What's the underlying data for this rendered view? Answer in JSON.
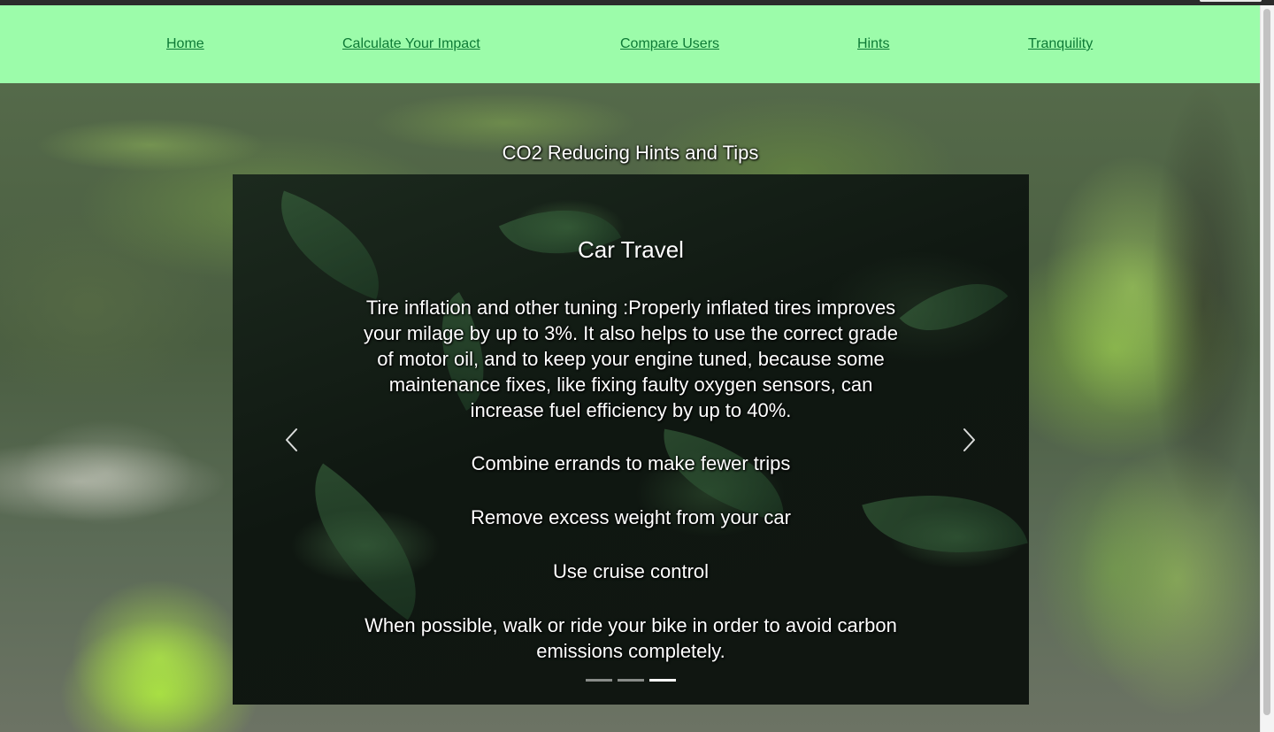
{
  "nav": {
    "items": [
      {
        "label": "Home"
      },
      {
        "label": "Calculate Your Impact"
      },
      {
        "label": "Compare Users"
      },
      {
        "label": "Hints"
      },
      {
        "label": "Tranquility"
      }
    ],
    "background_color": "#9cfcaa",
    "link_color": "#0e7a36"
  },
  "page": {
    "heading": "CO2 Reducing Hints and Tips"
  },
  "carousel": {
    "slide_title": "Car Travel",
    "hints": [
      "Tire inflation and other tuning :Properly inflated tires improves your milage by up to 3%. It also helps to use the correct grade of motor oil, and to keep your engine tuned, because some maintenance fixes, like fixing faulty oxygen sensors, can increase fuel efficiency by up to 40%.",
      "Combine errands to make fewer trips",
      "Remove excess weight from your car",
      "Use cruise control",
      "When possible, walk or ride your bike in order to avoid carbon emissions completely."
    ],
    "prev_icon": "chevron-left-icon",
    "next_icon": "chevron-right-icon",
    "slide_count": 3,
    "active_slide": 3
  }
}
